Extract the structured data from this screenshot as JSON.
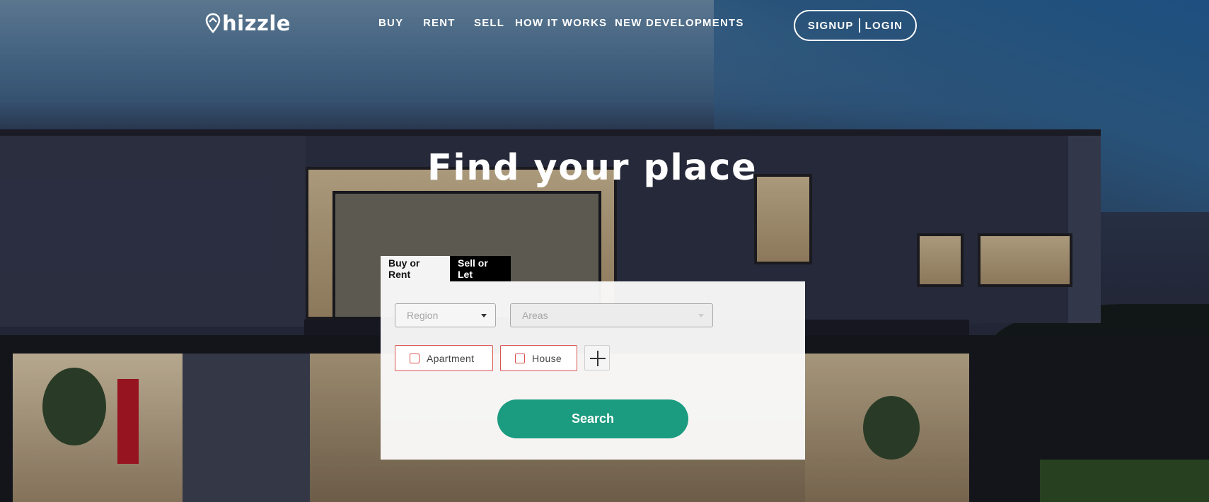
{
  "brand": {
    "logo_text": "hizzle"
  },
  "nav": {
    "items": [
      {
        "label": "BUY"
      },
      {
        "label": "RENT"
      },
      {
        "label": "SELL"
      },
      {
        "label": "HOW IT WORKS"
      },
      {
        "label": "NEW DEVELOPMENTS"
      }
    ]
  },
  "auth": {
    "signup_label": "SIGNUP",
    "login_label": "LOGIN"
  },
  "hero": {
    "title": "Find your place"
  },
  "search": {
    "tabs": [
      {
        "label": "Buy or Rent",
        "active": true
      },
      {
        "label": "Sell or Let",
        "active": false
      }
    ],
    "region": {
      "placeholder": "Region"
    },
    "areas": {
      "placeholder": "Areas"
    },
    "property_types": [
      {
        "label": "Apartment",
        "checked": false
      },
      {
        "label": "House",
        "checked": false
      }
    ],
    "submit_label": "Search"
  },
  "colors": {
    "accent": "#1b9b7f",
    "chip_border": "#d9534f"
  }
}
